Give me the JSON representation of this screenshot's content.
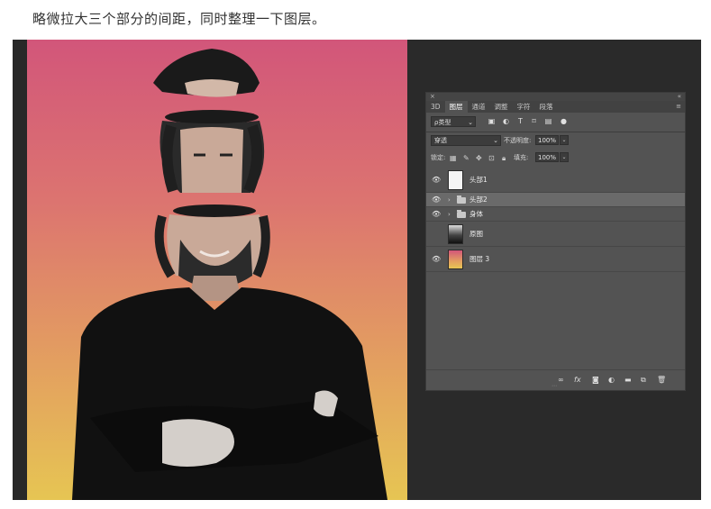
{
  "caption": "略微拉大三个部分的间距，同时整理一下图层。",
  "panel": {
    "tabs": [
      "3D",
      "图层",
      "通道",
      "调整",
      "字符",
      "段落"
    ],
    "active_tab": "图层",
    "filter_label": "ρ类型",
    "blend_mode": "穿透",
    "opacity_label": "不透明度:",
    "opacity_value": "100%",
    "lock_label": "锁定:",
    "fill_label": "填充:",
    "fill_value": "100%",
    "layers": [
      {
        "name": "头部1",
        "visible": true,
        "type": "layer",
        "thumb": "white"
      },
      {
        "name": "头部2",
        "visible": true,
        "type": "group",
        "selected": true
      },
      {
        "name": "身体",
        "visible": true,
        "type": "group"
      },
      {
        "name": "原图",
        "visible": false,
        "type": "layer",
        "thumb": "photo"
      },
      {
        "name": "图层 3",
        "visible": true,
        "type": "layer",
        "thumb": "gradient"
      }
    ],
    "bottom_icons": [
      "link-icon",
      "fx-icon",
      "mask-icon",
      "adjustment-icon",
      "folder-icon",
      "new-layer-icon",
      "trash-icon"
    ],
    "colors": {
      "panel_bg": "#535353",
      "selected_row": "#6a6a6a",
      "canvas_top": "#d2567a",
      "canvas_bottom": "#e6c553"
    }
  }
}
